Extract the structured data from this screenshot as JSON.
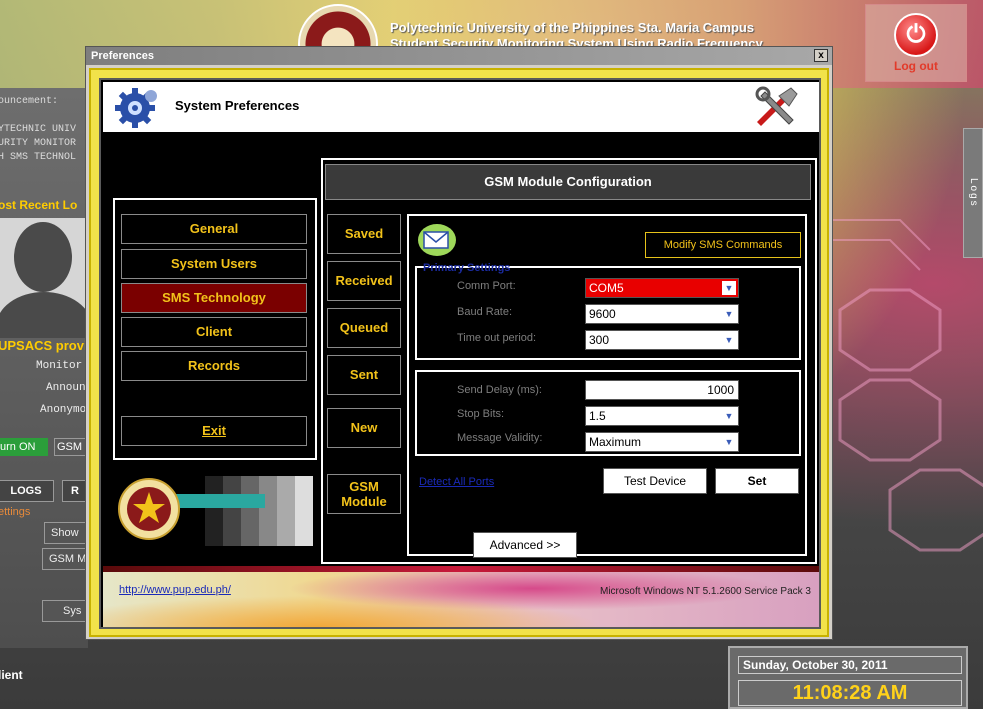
{
  "background": {
    "title_line1": "Polytechnic University of the Phippines Sta. Maria Campus",
    "title_line2": "Student Security Monitoring System Using Radio Frequency",
    "logout_label": "Log out",
    "announcement_label": "ouncement:",
    "announce_lines": [
      "YTECHNIC UNIV",
      "URITY MONITOR",
      "H SMS TECHNOL"
    ],
    "recent_label": "ost Recent Lo",
    "upsacs_label": "UPSACS provi",
    "monitor_label": "Monitor",
    "announce_short": "Announ",
    "anonym_label": "Anonymo",
    "turn_on_label": "urn ON",
    "gsm_small_label": "GSM",
    "logs_btn_label": "LOGS",
    "r_btn_label": "R",
    "settings_label": "ettings",
    "show_label": "Show",
    "gsm_m_label": "GSM M",
    "sys_label": "Sys",
    "client_label": "lient",
    "logs_tab_label": "Logs",
    "date": "Sunday, October 30, 2011",
    "time": "11:08:28 AM"
  },
  "dialog": {
    "window_title": "Preferences",
    "close_glyph": "x",
    "header_title": "System Preferences",
    "menu": [
      {
        "label": "General",
        "active": false
      },
      {
        "label": "System Users",
        "active": false
      },
      {
        "label": "SMS Technology",
        "active": true
      },
      {
        "label": "Client",
        "active": false
      },
      {
        "label": "Records",
        "active": false
      }
    ],
    "exit_label": "Exit",
    "panel_title": "GSM Module Configuration",
    "side_buttons": [
      "Saved",
      "Received",
      "Queued",
      "Sent",
      "New"
    ],
    "gsm_module_line1": "GSM",
    "gsm_module_line2": "Module",
    "modify_sms_commands": "Modify SMS Commands",
    "primary_settings_label": "Primary Settings",
    "comm_port_label": "Comm Port:",
    "comm_port_value": "COM5",
    "baud_rate_label": "Baud Rate:",
    "baud_rate_value": "9600",
    "timeout_label": "Time out period:",
    "timeout_value": "300",
    "send_delay_label": "Send Delay (ms):",
    "send_delay_value": "1000",
    "stop_bits_label": "Stop Bits:",
    "stop_bits_value": "1.5",
    "validity_label": "Message Validity:",
    "validity_value": "Maximum",
    "detect_all_ports": "Detect All Ports",
    "test_device": "Test Device",
    "set_label": "Set",
    "advanced_label": "Advanced >>",
    "footer_link": "http://www.pup.edu.ph/",
    "footer_os": "Microsoft Windows NT 5.1.2600 Service Pack 3",
    "combo_arrow_glyph": "▼"
  },
  "colors": {
    "accent_yellow": "#f2c21a",
    "active_menu": "#7a0000",
    "comm_port_highlight": "#e80000",
    "link_blue": "#1a2ab8"
  }
}
